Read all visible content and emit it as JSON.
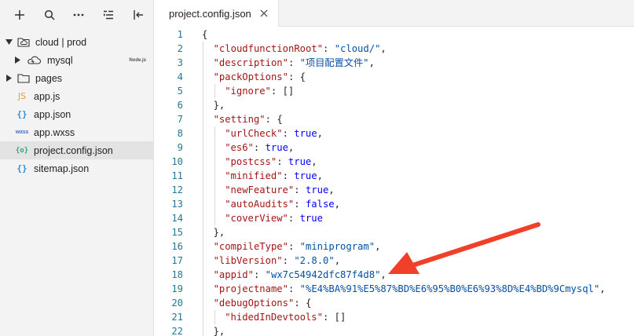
{
  "sidebar": {
    "toolbar": [
      "add-icon",
      "search-icon",
      "more-icon",
      "outline-icon",
      "collapse-icon"
    ],
    "items": [
      {
        "label": "cloud | prod",
        "type": "cloud-folder",
        "expanded": true
      },
      {
        "label": "mysql",
        "type": "cloud-function",
        "badge": "Node.js"
      },
      {
        "label": "pages",
        "type": "folder",
        "expanded": false
      },
      {
        "label": "app.js",
        "type": "js",
        "icon_text": "JS"
      },
      {
        "label": "app.json",
        "type": "json",
        "icon_text": "{}"
      },
      {
        "label": "app.wxss",
        "type": "wxss",
        "icon_text": "wxss"
      },
      {
        "label": "project.config.json",
        "type": "config",
        "icon_text": "{o}",
        "selected": true
      },
      {
        "label": "sitemap.json",
        "type": "json",
        "icon_text": "{}"
      }
    ]
  },
  "editor": {
    "tab_label": "project.config.json",
    "lines": [
      {
        "n": "1",
        "indent": 0,
        "tokens": [
          [
            "p",
            "{"
          ]
        ]
      },
      {
        "n": "2",
        "indent": 1,
        "tokens": [
          [
            "k",
            "\"cloudfunctionRoot\""
          ],
          [
            "p",
            ": "
          ],
          [
            "s",
            "\"cloud/\""
          ],
          [
            "p",
            ","
          ]
        ]
      },
      {
        "n": "3",
        "indent": 1,
        "tokens": [
          [
            "k",
            "\"description\""
          ],
          [
            "p",
            ": "
          ],
          [
            "s",
            "\"项目配置文件\""
          ],
          [
            "p",
            ","
          ]
        ]
      },
      {
        "n": "4",
        "indent": 1,
        "tokens": [
          [
            "k",
            "\"packOptions\""
          ],
          [
            "p",
            ": {"
          ]
        ]
      },
      {
        "n": "5",
        "indent": 2,
        "tokens": [
          [
            "k",
            "\"ignore\""
          ],
          [
            "p",
            ": []"
          ]
        ]
      },
      {
        "n": "6",
        "indent": 1,
        "tokens": [
          [
            "p",
            "},"
          ]
        ]
      },
      {
        "n": "7",
        "indent": 1,
        "tokens": [
          [
            "k",
            "\"setting\""
          ],
          [
            "p",
            ": {"
          ]
        ]
      },
      {
        "n": "8",
        "indent": 2,
        "tokens": [
          [
            "k",
            "\"urlCheck\""
          ],
          [
            "p",
            ": "
          ],
          [
            "v",
            "true"
          ],
          [
            "p",
            ","
          ]
        ]
      },
      {
        "n": "9",
        "indent": 2,
        "tokens": [
          [
            "k",
            "\"es6\""
          ],
          [
            "p",
            ": "
          ],
          [
            "v",
            "true"
          ],
          [
            "p",
            ","
          ]
        ]
      },
      {
        "n": "10",
        "indent": 2,
        "tokens": [
          [
            "k",
            "\"postcss\""
          ],
          [
            "p",
            ": "
          ],
          [
            "v",
            "true"
          ],
          [
            "p",
            ","
          ]
        ]
      },
      {
        "n": "11",
        "indent": 2,
        "tokens": [
          [
            "k",
            "\"minified\""
          ],
          [
            "p",
            ": "
          ],
          [
            "v",
            "true"
          ],
          [
            "p",
            ","
          ]
        ]
      },
      {
        "n": "12",
        "indent": 2,
        "tokens": [
          [
            "k",
            "\"newFeature\""
          ],
          [
            "p",
            ": "
          ],
          [
            "v",
            "true"
          ],
          [
            "p",
            ","
          ]
        ]
      },
      {
        "n": "13",
        "indent": 2,
        "tokens": [
          [
            "k",
            "\"autoAudits\""
          ],
          [
            "p",
            ": "
          ],
          [
            "v",
            "false"
          ],
          [
            "p",
            ","
          ]
        ]
      },
      {
        "n": "14",
        "indent": 2,
        "tokens": [
          [
            "k",
            "\"coverView\""
          ],
          [
            "p",
            ": "
          ],
          [
            "v",
            "true"
          ]
        ]
      },
      {
        "n": "15",
        "indent": 1,
        "tokens": [
          [
            "p",
            "},"
          ]
        ]
      },
      {
        "n": "16",
        "indent": 1,
        "tokens": [
          [
            "k",
            "\"compileType\""
          ],
          [
            "p",
            ": "
          ],
          [
            "s",
            "\"miniprogram\""
          ],
          [
            "p",
            ","
          ]
        ]
      },
      {
        "n": "17",
        "indent": 1,
        "tokens": [
          [
            "k",
            "\"libVersion\""
          ],
          [
            "p",
            ": "
          ],
          [
            "s",
            "\"2.8.0\""
          ],
          [
            "p",
            ","
          ]
        ]
      },
      {
        "n": "18",
        "indent": 1,
        "tokens": [
          [
            "k",
            "\"appid\""
          ],
          [
            "p",
            ": "
          ],
          [
            "s",
            "\"wx7c54942dfc87f4d8\""
          ],
          [
            "p",
            ","
          ]
        ]
      },
      {
        "n": "19",
        "indent": 1,
        "tokens": [
          [
            "k",
            "\"projectname\""
          ],
          [
            "p",
            ": "
          ],
          [
            "s",
            "\"%E4%BA%91%E5%87%BD%E6%95%B0%E6%93%8D%E4%BD%9Cmysql\""
          ],
          [
            "p",
            ","
          ]
        ]
      },
      {
        "n": "20",
        "indent": 1,
        "tokens": [
          [
            "k",
            "\"debugOptions\""
          ],
          [
            "p",
            ": {"
          ]
        ]
      },
      {
        "n": "21",
        "indent": 2,
        "tokens": [
          [
            "k",
            "\"hidedInDevtools\""
          ],
          [
            "p",
            ": []"
          ]
        ]
      },
      {
        "n": "22",
        "indent": 1,
        "tokens": [
          [
            "p",
            "},"
          ]
        ]
      }
    ]
  },
  "annotation": {
    "type": "arrow",
    "color": "#f0402a",
    "target_line": "18"
  },
  "colors": {
    "key": "#a31515",
    "string": "#0451a5",
    "keyword": "#0000ff",
    "line_number": "#237893",
    "sidebar_bg": "#f3f3f3",
    "selection": "#e3e3e3"
  }
}
